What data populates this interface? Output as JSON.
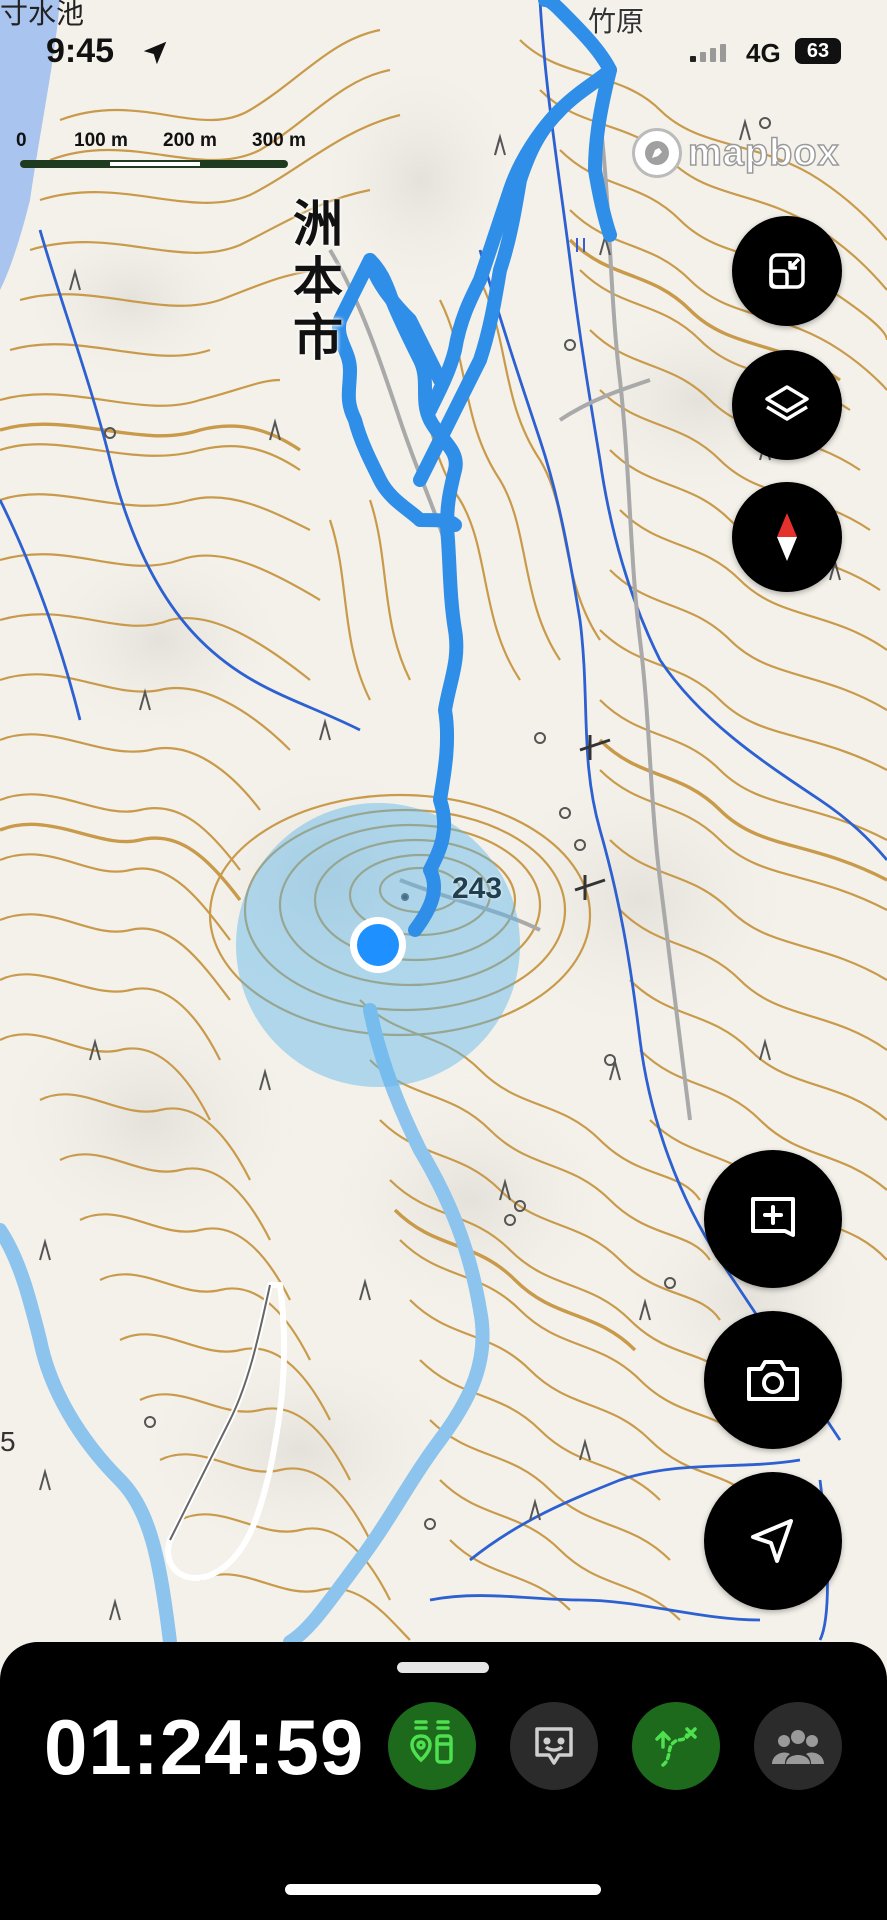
{
  "status_bar": {
    "time": "9:45",
    "network": "4G",
    "battery": "63"
  },
  "map": {
    "corner_label": "寸水池",
    "city_label": "洲本市",
    "place_label": "竹原",
    "elevation_label": "243",
    "left_edge_label": "5",
    "attribution": "mapbox",
    "scale": {
      "labels": [
        "0",
        "100 m",
        "200 m",
        "300 m"
      ]
    },
    "colors": {
      "contour": "#c89a4a",
      "route": "#2f8ee8",
      "river": "#2d60d0",
      "accuracy": "#5ab6ec",
      "location_dot": "#1e90ff"
    }
  },
  "controls": {
    "fullscreen_icon": "shrink-icon",
    "layers_icon": "layers-icon",
    "compass_icon": "compass-icon",
    "add_note_icon": "add-note-icon",
    "camera_icon": "camera-icon",
    "locate_icon": "navigation-arrow-icon"
  },
  "bottom_sheet": {
    "elapsed_time": "01:24:59",
    "buttons": [
      {
        "icon": "trail-markers-icon",
        "active": true
      },
      {
        "icon": "message-icon",
        "active": false
      },
      {
        "icon": "route-icon",
        "active": true
      },
      {
        "icon": "group-icon",
        "active": false
      }
    ]
  }
}
